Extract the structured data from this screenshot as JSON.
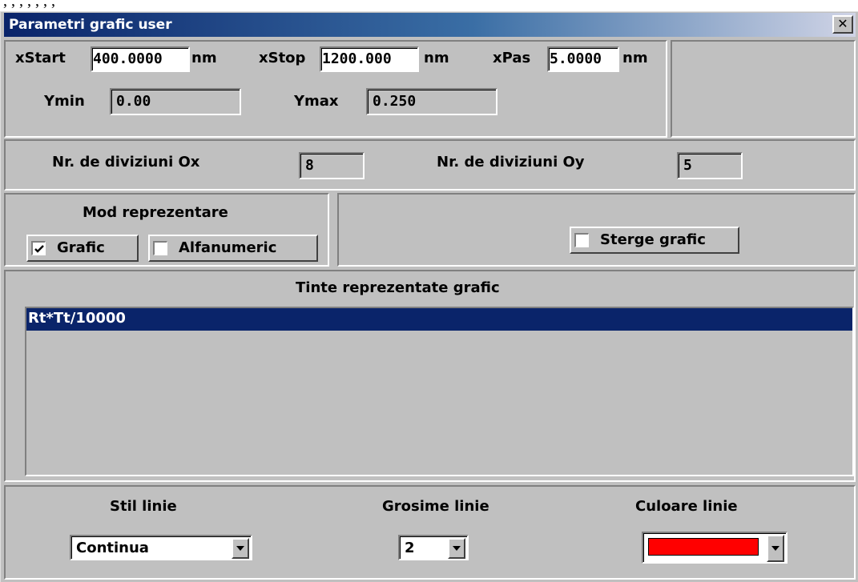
{
  "window": {
    "title": "Parametri grafic user",
    "close_label": "x"
  },
  "range": {
    "xstart_label": "xStart",
    "xstart_value": "400.0000",
    "xstart_unit": "nm",
    "xstop_label": "xStop",
    "xstop_value": "1200.000",
    "xstop_unit": "nm",
    "xpas_label": "xPas",
    "xpas_value": "5.0000",
    "xpas_unit": "nm",
    "ymin_label": "Ymin",
    "ymin_value": "0.00",
    "ymax_label": "Ymax",
    "ymax_value": "0.250"
  },
  "divisions": {
    "ox_label": "Nr. de diviziuni Ox",
    "ox_value": "8",
    "oy_label": "Nr. de diviziuni Oy",
    "oy_value": "5"
  },
  "mode": {
    "title": "Mod reprezentare",
    "grafic_label": "Grafic",
    "grafic_checked": true,
    "alfanumeric_label": "Alfanumeric",
    "alfanumeric_checked": false
  },
  "sterge": {
    "label": "Sterge grafic",
    "checked": false
  },
  "targets": {
    "title": "Tinte reprezentate grafic",
    "items": [
      "Rt*Tt/10000"
    ],
    "selected_index": 0
  },
  "line": {
    "style_label": "Stil linie",
    "style_value": "Continua",
    "thickness_label": "Grosime linie",
    "thickness_value": "2",
    "color_label": "Culoare linie",
    "color_value": "#ff0000"
  },
  "colors": {
    "face": "#c0c0c0",
    "selection": "#0a246a"
  },
  "icons": {
    "close": "close-icon",
    "dropdown": "chevron-down-icon",
    "check": "checkmark-icon"
  }
}
